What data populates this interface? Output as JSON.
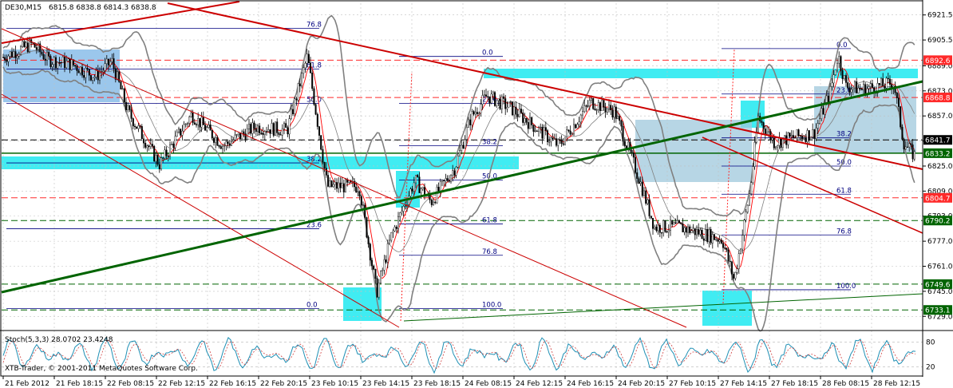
{
  "header": {
    "symbol_label": "DE30,M15",
    "ohlc_label": "6815.8 6838.8 6814.3 6838.8"
  },
  "oscillator": {
    "label": "Stoch(5,3,3) 28.0702 23.4248",
    "levels": [
      80,
      20
    ],
    "level_labels": [
      "80",
      "20"
    ]
  },
  "copyright": "XTB-Trader, © 2001-2011 MetaQuotes Software Corp.",
  "colors": {
    "background": "#ffffff",
    "grid": "#c0c0c0",
    "candle": "#000000",
    "bollinger": "#808080",
    "ma": "#ff0000",
    "trend_red": "#cc0000",
    "trend_green": "#006400",
    "zone_cyan": "#00e5ee",
    "zone_blue": "#7ab4e6",
    "zone_gray_blue": "#9fc8dc",
    "fib": "#000080",
    "tag_red": "#ff2a2a",
    "tag_green": "#006400",
    "tag_black": "#000000",
    "stoch_main": "#1e8fb4",
    "stoch_signal": "#d04040"
  },
  "chart_data": {
    "type": "candlestick",
    "title": "DE30,M15",
    "y_axis_labels": [
      "6921.5",
      "6905.5",
      "6889.0",
      "6873.0",
      "6857.0",
      "6841.0",
      "6825.0",
      "6809.0",
      "6793.0",
      "6777.0",
      "6761.0",
      "6745.0",
      "6729.0"
    ],
    "ylim": [
      6722,
      6929
    ],
    "x_axis_labels": [
      "21 Feb 2012",
      "21 Feb 18:15",
      "22 Feb 08:15",
      "22 Feb 12:15",
      "22 Feb 16:15",
      "22 Feb 20:15",
      "23 Feb 10:15",
      "23 Feb 14:15",
      "23 Feb 18:15",
      "24 Feb 08:15",
      "24 Feb 12:15",
      "24 Feb 16:15",
      "24 Feb 20:15",
      "27 Feb 10:15",
      "27 Feb 14:15",
      "27 Feb 18:15",
      "28 Feb 08:15",
      "28 Feb 12:15"
    ],
    "price_tags": [
      {
        "label": "6892.6",
        "value": 6892.6,
        "style": "red"
      },
      {
        "label": "6868.8",
        "value": 6868.8,
        "style": "red"
      },
      {
        "label": "6841.7",
        "value": 6841.7,
        "style": "black"
      },
      {
        "label": "6833.2",
        "value": 6833.2,
        "style": "green"
      },
      {
        "label": "6804.7",
        "value": 6804.7,
        "style": "red"
      },
      {
        "label": "6790.2",
        "value": 6790.2,
        "style": "green"
      },
      {
        "label": "6749.6",
        "value": 6749.6,
        "style": "green"
      },
      {
        "label": "6733.1",
        "value": 6733.1,
        "style": "green"
      }
    ],
    "horizontal_levels": [
      {
        "value": 6892.6,
        "color": "red",
        "dash": true
      },
      {
        "value": 6868.8,
        "color": "red",
        "dash": true
      },
      {
        "value": 6804.7,
        "color": "red",
        "dash": true
      },
      {
        "value": 6841.7,
        "color": "black",
        "dash": true
      },
      {
        "value": 6833.2,
        "color": "green",
        "dash": false
      },
      {
        "value": 6790.2,
        "color": "green",
        "dash": true
      },
      {
        "value": 6749.6,
        "color": "green",
        "dash": true
      },
      {
        "value": 6733.1,
        "color": "green",
        "dash": true
      }
    ],
    "fib_sets": [
      {
        "levels": [
          {
            "label": "76.8",
            "value": 6913
          },
          {
            "label": "61.8",
            "value": 6887
          },
          {
            "label": "50.0",
            "value": 6865
          },
          {
            "label": "38.2",
            "value": 6827
          },
          {
            "label": "23.6",
            "value": 6785
          },
          {
            "label": "0.0",
            "value": 6734
          }
        ]
      },
      {
        "levels": [
          {
            "label": "0.0",
            "value": 6895
          },
          {
            "label": "23.6",
            "value": 6865
          },
          {
            "label": "38.2",
            "value": 6838
          },
          {
            "label": "50.0",
            "value": 6816
          },
          {
            "label": "61.8",
            "value": 6788
          },
          {
            "label": "76.8",
            "value": 6768
          },
          {
            "label": "100.0",
            "value": 6734
          }
        ]
      },
      {
        "levels": [
          {
            "label": "0.0",
            "value": 6900
          },
          {
            "label": "23.6",
            "value": 6871
          },
          {
            "label": "38.2",
            "value": 6843
          },
          {
            "label": "50.0",
            "value": 6825
          },
          {
            "label": "61.8",
            "value": 6807
          },
          {
            "label": "76.8",
            "value": 6781
          },
          {
            "label": "100.0",
            "value": 6746
          }
        ]
      }
    ]
  }
}
